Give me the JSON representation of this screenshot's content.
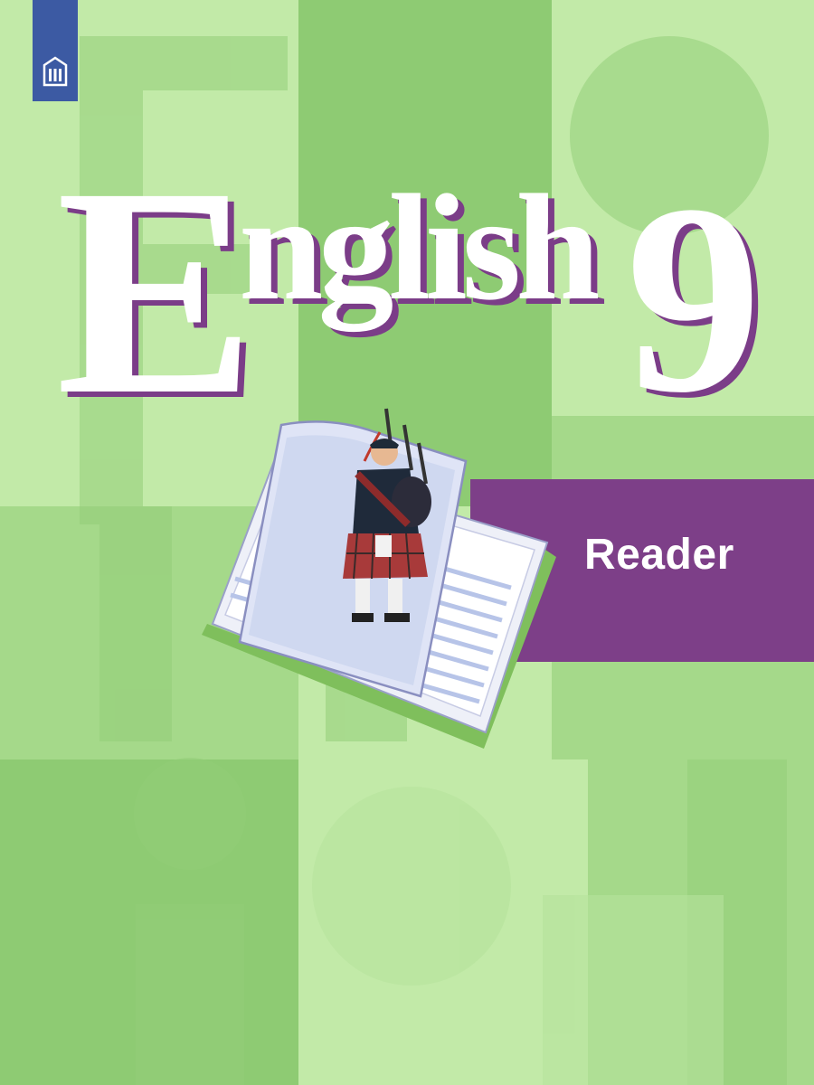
{
  "cover": {
    "title_initial": "E",
    "title_rest": "nglish",
    "grade": "9",
    "band_label": "Reader"
  },
  "colors": {
    "background_light": "#c2eaa8",
    "background_mid": "#a5d98a",
    "background_dark": "#8ecb73",
    "title_text": "#ffffff",
    "title_shadow": "#7b3d88",
    "band": "#7d3f88",
    "logo": "#3c5aa3"
  },
  "icons": {
    "publisher_logo": "prosveshchenie-logo",
    "illustration": "open-book-with-bagpiper"
  }
}
